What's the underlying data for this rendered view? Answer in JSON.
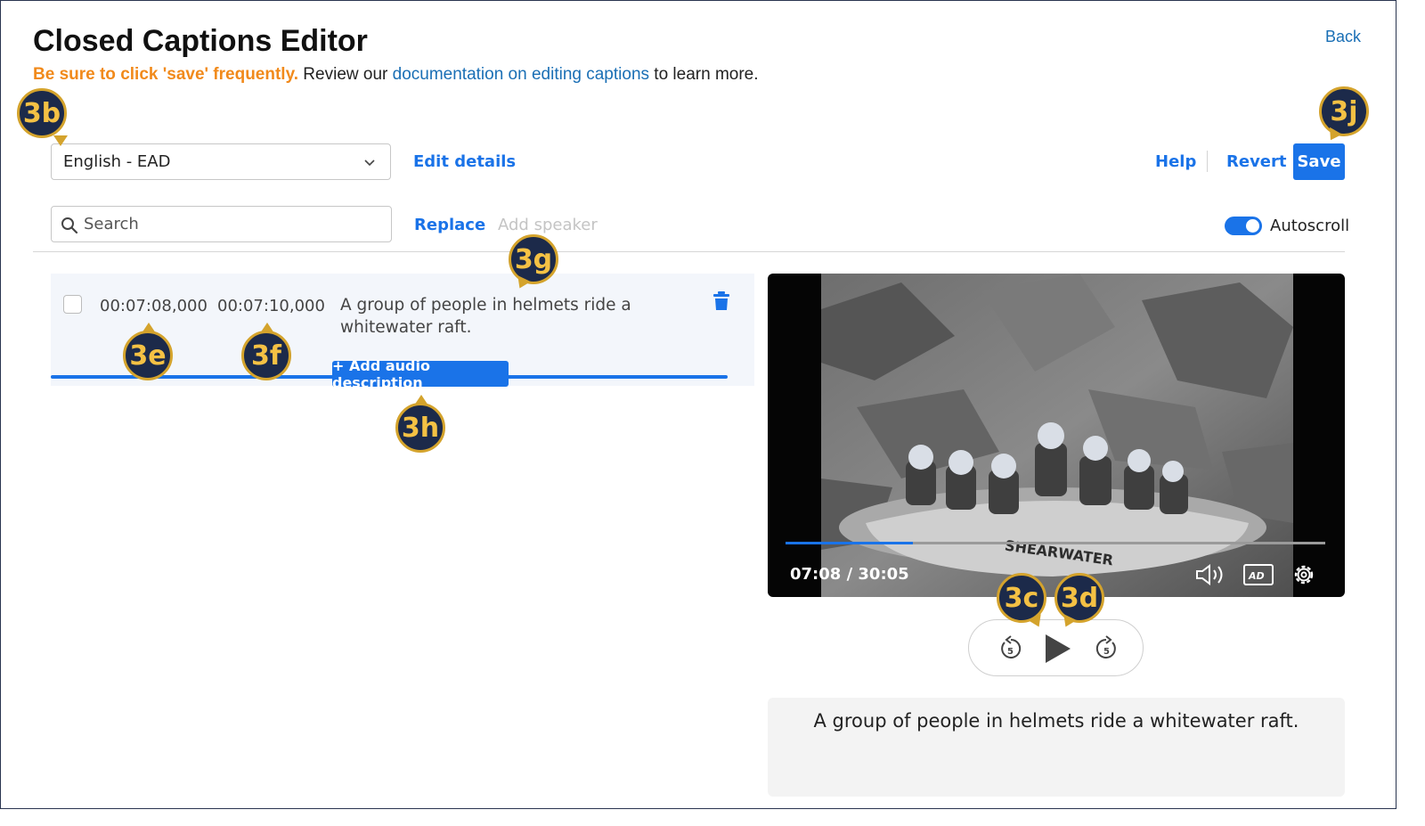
{
  "header": {
    "title": "Closed Captions Editor",
    "back_label": "Back",
    "warning": "Be sure to click 'save' frequently.",
    "review_prefix": " Review our ",
    "doc_link": "documentation on editing captions",
    "review_suffix": " to learn more."
  },
  "toolbar": {
    "language_value": "English - EAD",
    "edit_details_label": "Edit details",
    "help_label": "Help",
    "revert_label": "Revert",
    "save_label": "Save",
    "search_placeholder": "Search",
    "replace_label": "Replace",
    "add_speaker_label": "Add speaker",
    "autoscroll_label": "Autoscroll",
    "autoscroll_on": true
  },
  "captions": [
    {
      "start": "00:07:08,000",
      "end": "00:07:10,000",
      "text": "A group of people in helmets ride a whitewater raft.",
      "add_ad_label": "+ Add audio description"
    }
  ],
  "player": {
    "time_display": "07:08 / 30:05",
    "progress_fraction": 0.236,
    "boat_lettering": "SHEARWATER",
    "ad_badge": "AD",
    "skip_seconds": "5",
    "caption_preview": "A group of people in helmets ride a whitewater raft."
  },
  "callouts": [
    "3b",
    "3j",
    "3e",
    "3f",
    "3g",
    "3h",
    "3c",
    "3d"
  ],
  "colors": {
    "accent": "#1a73e8",
    "warning": "#f18a1b",
    "link": "#1a6fb5",
    "callout_bg": "#1c2a4a",
    "callout_ring": "#d4a32c",
    "callout_text": "#f4c144"
  },
  "icons": [
    "chevron-down-icon",
    "search-icon",
    "trash-icon",
    "volume-icon",
    "audio-description-icon",
    "gear-icon",
    "rewind-5-icon",
    "play-icon",
    "forward-5-icon"
  ]
}
